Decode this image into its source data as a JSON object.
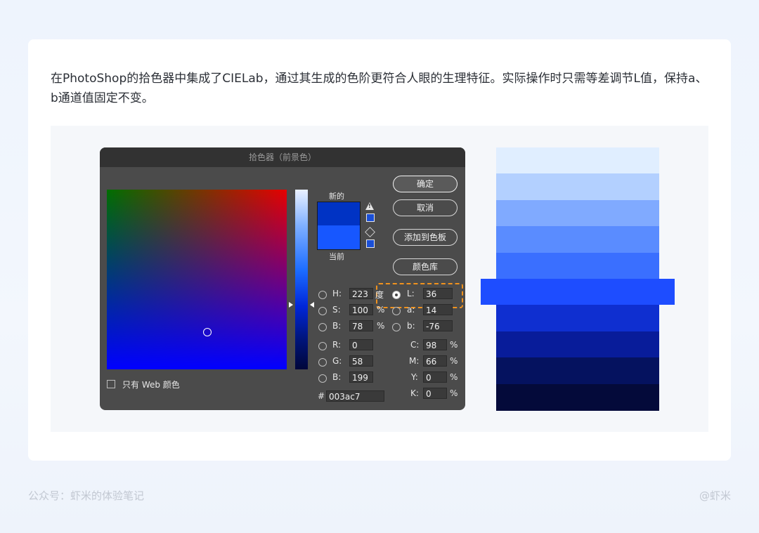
{
  "intro_text": "在PhotoShop的拾色器中集成了CIELab，通过其生成的色阶更符合人眼的生理特征。实际操作时只需等差调节L值，保持a、b通道值固定不变。",
  "footer": {
    "left": "公众号：虾米的体验笔记",
    "right": "@虾米"
  },
  "picker": {
    "title": "拾色器（前景色）",
    "label_new": "新的",
    "label_current": "当前",
    "colors": {
      "new": "#0033c4",
      "current": "#1757ff"
    },
    "buttons": {
      "ok": "确定",
      "cancel": "取消",
      "add_swatch": "添加到色板",
      "libraries": "颜色库"
    },
    "hsb": {
      "h_label": "H:",
      "h": "223",
      "h_unit": "度",
      "s_label": "S:",
      "s": "100",
      "s_unit": "%",
      "b_label": "B:",
      "b": "78",
      "b_unit": "%"
    },
    "lab": {
      "l_label": "L:",
      "l": "36",
      "a_label": "a:",
      "a": "14",
      "b_label": "b:",
      "b": "-76"
    },
    "rgb": {
      "r_label": "R:",
      "r": "0",
      "g_label": "G:",
      "g": "58",
      "b_label": "B:",
      "b": "199"
    },
    "cmyk": {
      "c_label": "C:",
      "c": "98",
      "m_label": "M:",
      "m": "66",
      "y_label": "Y:",
      "y": "0",
      "k_label": "K:",
      "k": "0",
      "unit": "%"
    },
    "hex_label": "#",
    "hex": "003ac7",
    "web_only_label": "只有 Web 颜色",
    "icons": [
      "gamut-warning-icon",
      "web-cube-icon",
      "radio-icon",
      "checkbox-icon"
    ]
  },
  "ramp": {
    "colors": [
      "#e0eeff",
      "#b3d0ff",
      "#80aaff",
      "#5a8cff",
      "#3a6fff",
      "#1e4dff",
      "#0f2fd0",
      "#081c9a",
      "#05125f",
      "#040a3a"
    ],
    "highlight_index": 5
  }
}
